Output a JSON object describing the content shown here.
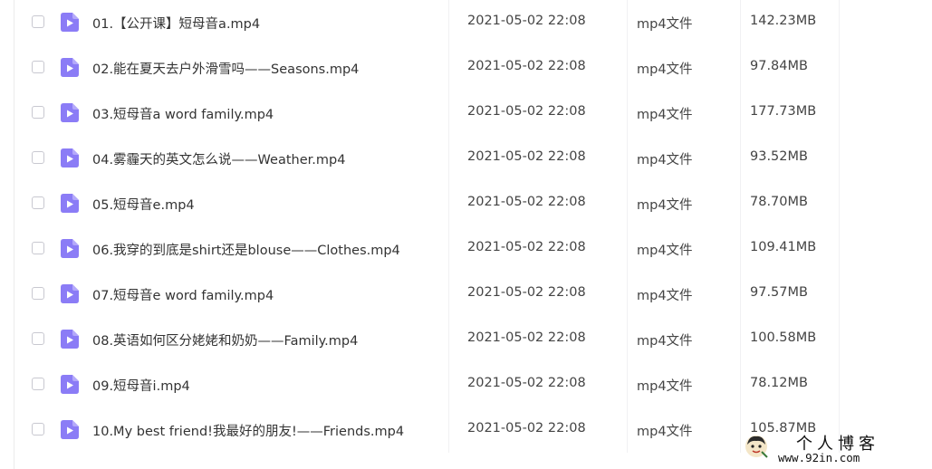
{
  "files": [
    {
      "name": "01.【公开课】短母音a.mp4",
      "date": "2021-05-02 22:08",
      "type": "mp4文件",
      "size": "142.23MB"
    },
    {
      "name": "02.能在夏天去户外滑雪吗——Seasons.mp4",
      "date": "2021-05-02 22:08",
      "type": "mp4文件",
      "size": "97.84MB"
    },
    {
      "name": "03.短母音a word family.mp4",
      "date": "2021-05-02 22:08",
      "type": "mp4文件",
      "size": "177.73MB"
    },
    {
      "name": "04.雾霾天的英文怎么说——Weather.mp4",
      "date": "2021-05-02 22:08",
      "type": "mp4文件",
      "size": "93.52MB"
    },
    {
      "name": "05.短母音e.mp4",
      "date": "2021-05-02 22:08",
      "type": "mp4文件",
      "size": "78.70MB"
    },
    {
      "name": "06.我穿的到底是shirt还是blouse——Clothes.mp4",
      "date": "2021-05-02 22:08",
      "type": "mp4文件",
      "size": "109.41MB"
    },
    {
      "name": "07.短母音e word family.mp4",
      "date": "2021-05-02 22:08",
      "type": "mp4文件",
      "size": "97.57MB"
    },
    {
      "name": "08.英语如何区分姥姥和奶奶——Family.mp4",
      "date": "2021-05-02 22:08",
      "type": "mp4文件",
      "size": "100.58MB"
    },
    {
      "name": "09.短母音i.mp4",
      "date": "2021-05-02 22:08",
      "type": "mp4文件",
      "size": "78.12MB"
    },
    {
      "name": "10.My best friend!我最好的朋友!——Friends.mp4",
      "date": "2021-05-02 22:08",
      "type": "mp4文件",
      "size": "105.87MB"
    }
  ],
  "watermark": {
    "title": "个人博客",
    "url": "www.92in.com"
  },
  "colors": {
    "icon": "#8b7cf6",
    "text": "#333333"
  },
  "icons": {
    "file": "video-file-icon",
    "checkbox": "checkbox"
  }
}
